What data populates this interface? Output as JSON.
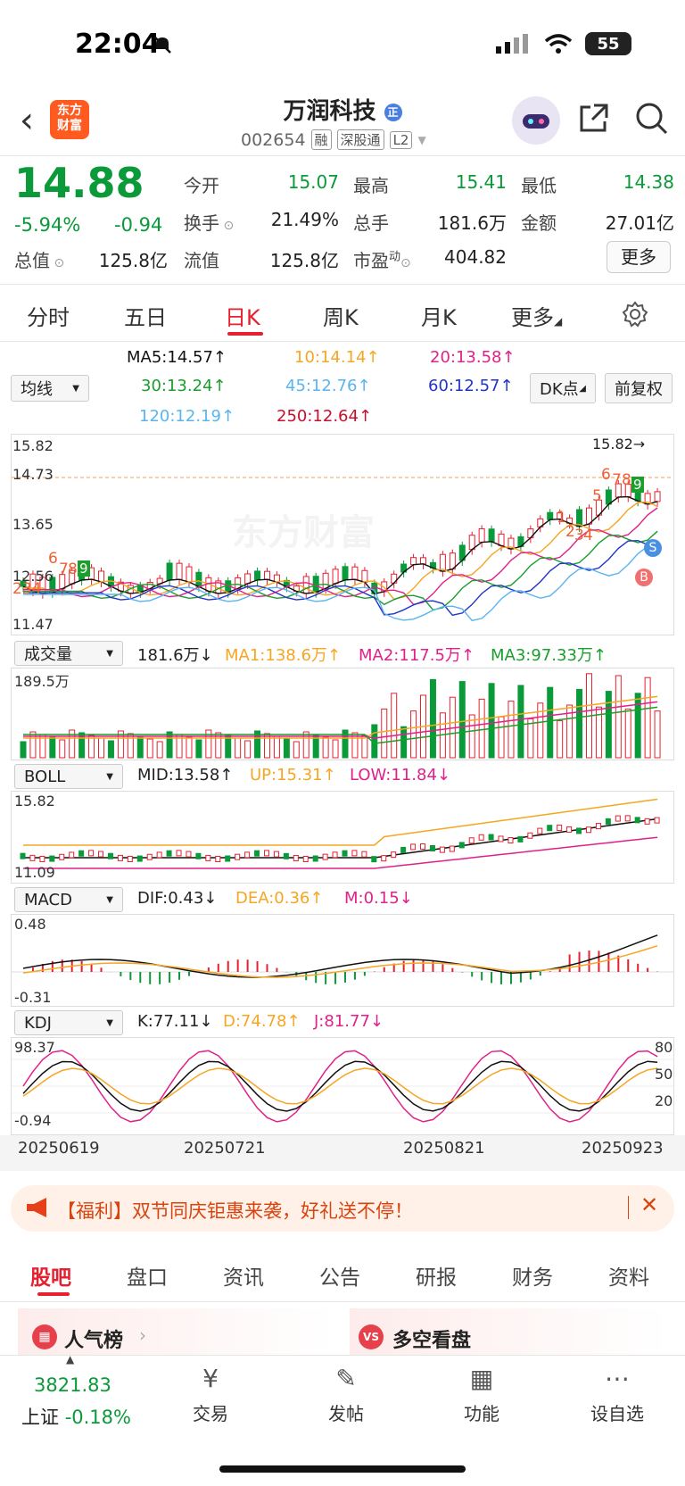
{
  "status": {
    "time": "22:04",
    "battery": "55"
  },
  "header": {
    "logo_line1": "东方",
    "logo_line2": "财富",
    "name": "万润科技",
    "badge": "正",
    "code": "002654",
    "tags": [
      "融",
      "深股通",
      "L2"
    ]
  },
  "quote": {
    "price": "14.88",
    "pct": "-5.94%",
    "change": "-0.94",
    "open_label": "今开",
    "open": "15.07",
    "high_label": "最高",
    "high": "15.41",
    "low_label": "最低",
    "low": "14.38",
    "turnover_label": "换手",
    "turnover": "21.49%",
    "vol_label": "总手",
    "vol": "181.6万",
    "amount_label": "金额",
    "amount": "27.01亿",
    "mcap_label": "总值",
    "mcap": "125.8亿",
    "float_label": "流值",
    "float": "125.8亿",
    "pe_label": "市盈",
    "pe_sup": "动",
    "pe": "404.82",
    "more": "更多"
  },
  "tabs": [
    "分时",
    "五日",
    "日K",
    "周K",
    "月K",
    "更多"
  ],
  "ma": {
    "select": "均线",
    "ma5": "MA5:14.57↑",
    "ma10": "10:14.14↑",
    "ma20": "20:13.58↑",
    "ma30": "30:13.24↑",
    "ma45": "45:12.76↑",
    "ma60": "60:12.57↑",
    "ma120": "120:12.19↑",
    "ma250": "250:12.64↑",
    "dk": "DK点",
    "adjust": "前复权",
    "colors": {
      "ma5": "#111111",
      "ma10": "#f5a623",
      "ma20": "#e0218a",
      "ma30": "#1a9e2c",
      "ma45": "#5ab4f0",
      "ma60": "#2234c8",
      "ma120": "#5ab4f0",
      "ma250": "#c8102e"
    }
  },
  "kline": {
    "y_labels": [
      "15.82",
      "14.73",
      "13.65",
      "12.56",
      "11.47"
    ],
    "max_mark": "15.82→",
    "labels_nums_left": [
      "234",
      "6",
      "7",
      "8",
      "9"
    ],
    "labels_nums_right": [
      "1",
      "2",
      "3",
      "4",
      "5",
      "6",
      "7",
      "8",
      "9"
    ],
    "s_label": "S",
    "b_label": "B",
    "watermark": "东方财富"
  },
  "volume": {
    "select": "成交量",
    "val": "181.6万↓",
    "ma1": "MA1:138.6万↑",
    "ma2": "MA2:117.5万↑",
    "ma3": "MA3:97.33万↑",
    "top": "189.5万"
  },
  "boll": {
    "select": "BOLL",
    "mid": "MID:13.58↑",
    "up": "UP:15.31↑",
    "low": "LOW:11.84↓",
    "top": "15.82",
    "bottom": "11.09"
  },
  "macd": {
    "select": "MACD",
    "dif": "DIF:0.43↓",
    "dea": "DEA:0.36↑",
    "m": "M:0.15↓",
    "top": "0.48",
    "bottom": "-0.31"
  },
  "kdj": {
    "select": "KDJ",
    "k": "K:77.11↓",
    "d": "D:74.78↑",
    "j": "J:81.77↓",
    "top": "98.37",
    "bottom": "-0.94",
    "r80": "80",
    "r50": "50",
    "r20": "20"
  },
  "dates": [
    "20250619",
    "20250721",
    "20250821",
    "20250923"
  ],
  "banner": {
    "text": "【福利】双节同庆钜惠来袭，好礼送不停！"
  },
  "bottom_tabs": [
    "股吧",
    "盘口",
    "资讯",
    "公告",
    "研报",
    "财务",
    "资料"
  ],
  "cards": {
    "popular": "人气榜",
    "longshort": "多空看盘"
  },
  "nav": {
    "index_value": "3821.83",
    "index_name": "上证",
    "index_pct": "-0.18%",
    "trade": "交易",
    "post": "发帖",
    "func": "功能",
    "watch": "设自选"
  }
}
